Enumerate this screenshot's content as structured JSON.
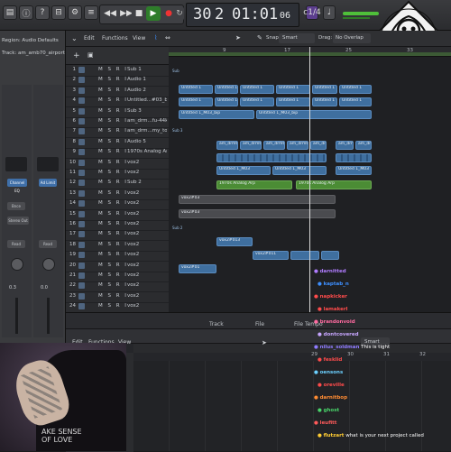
{
  "transport": {
    "rewind_icon": "rewind-icon",
    "forward_icon": "fast-forward-icon",
    "stop_icon": "stop-icon",
    "play_icon": "play-icon",
    "record_icon": "record-icon",
    "bar": "30",
    "beat": "2",
    "time": "01:01",
    "time_frac": "06",
    "key_label": "c1/4"
  },
  "tracks_toolbar": {
    "edit": "Edit",
    "functions": "Functions",
    "view": "View",
    "snap_label": "Snap:",
    "snap_value": "Smart",
    "drag_label": "Drag:",
    "drag_value": "No Overlap"
  },
  "inspector": {
    "region_line": "Region: Audio Defaults",
    "track_line": "Track: am_amb70_airport",
    "channel_eq": "Channel EQ",
    "ad_limit": "Ad Limit",
    "stereo_out": "Stereo Out",
    "read_left": "Read",
    "read_right": "Read",
    "bnce": "Bnce",
    "val_left": "0.3",
    "val_right": "0.0"
  },
  "ruler": [
    "9",
    "17",
    "25",
    "33"
  ],
  "tracks": [
    {
      "num": "1",
      "name": "Sub 1"
    },
    {
      "num": "2",
      "name": "Audio 1"
    },
    {
      "num": "3",
      "name": "Audio 2"
    },
    {
      "num": "4",
      "name": "Untitled...#03_bip"
    },
    {
      "num": "5",
      "name": "Sub 3"
    },
    {
      "num": "6",
      "name": "am_drm...fu-44k"
    },
    {
      "num": "7",
      "name": "am_drm...my_top"
    },
    {
      "num": "8",
      "name": "Audio 5"
    },
    {
      "num": "9",
      "name": "1970s Analog Arp"
    },
    {
      "num": "10",
      "name": "vox2"
    },
    {
      "num": "11",
      "name": "vox2"
    },
    {
      "num": "12",
      "name": "Sub 2"
    },
    {
      "num": "13",
      "name": "vox2"
    },
    {
      "num": "14",
      "name": "vox2"
    },
    {
      "num": "15",
      "name": "vox2"
    },
    {
      "num": "16",
      "name": "vox2"
    },
    {
      "num": "17",
      "name": "vox2"
    },
    {
      "num": "18",
      "name": "vox2"
    },
    {
      "num": "19",
      "name": "vox2"
    },
    {
      "num": "20",
      "name": "vox2"
    },
    {
      "num": "21",
      "name": "vox2"
    },
    {
      "num": "22",
      "name": "vox2"
    },
    {
      "num": "23",
      "name": "vox2"
    },
    {
      "num": "24",
      "name": "vox2"
    }
  ],
  "regions": {
    "sub1": "Sub 1",
    "untitled": "Untitled 1",
    "untitled_bip": "Untitled 1_M03_bip",
    "sub3": "Sub 3",
    "am_drm": "am_drm60",
    "untitled_m03": "Untitled 1_M03",
    "arp": "1970s Analog Arp",
    "vox_a": "vox2#03",
    "vox_b": "vox2#03",
    "sub2": "Sub 2",
    "vox_c": "vox2#013",
    "vox_d": "vox2#011",
    "vox_e": "vox2#01"
  },
  "editor": {
    "tab_track": "Track",
    "tab_file": "File",
    "tab_file_tempo": "File Tempo",
    "edit": "Edit",
    "functions": "Functions",
    "view": "View",
    "snap_value": "Smart",
    "ruler": [
      "29",
      "30",
      "31",
      "32"
    ]
  },
  "webcam": {
    "shirt_text": "AKE SENSE\nOF LOVE"
  },
  "chat": [
    {
      "name": "darnitted",
      "text": "",
      "color": "#b07cff"
    },
    {
      "name": "kaptab_n",
      "text": "",
      "color": "#3d8fff"
    },
    {
      "name": "napkicker",
      "text": "",
      "color": "#ff4b4b"
    },
    {
      "name": "lamakerl",
      "text": "",
      "color": "#ff4b4b"
    },
    {
      "name": "brandonvoid",
      "text": "",
      "color": "#ff6aa0"
    },
    {
      "name": "dontcovered",
      "text": "",
      "color": "#c7a6ff"
    },
    {
      "name": "nilus_soldman",
      "text": "This is tight",
      "color": "#8f7bff"
    },
    {
      "name": "fesklid",
      "text": "",
      "color": "#ff4b4b"
    },
    {
      "name": "oensons",
      "text": "",
      "color": "#6cd0ff"
    },
    {
      "name": "oreville",
      "text": "",
      "color": "#ff4b4b"
    },
    {
      "name": "darnitbop",
      "text": "",
      "color": "#ff8c33"
    },
    {
      "name": "ghost",
      "text": "",
      "color": "#49d46a"
    },
    {
      "name": "leufitt",
      "text": "",
      "color": "#ff5a5a"
    },
    {
      "name": "flutzart",
      "text": "what is your next project called",
      "color": "#ffcc33"
    }
  ],
  "colors": {
    "accent_green": "#4fbf3a",
    "region_blue": "#3f6f9f",
    "region_green": "#4b8c35",
    "playhead": "#d9d9d9"
  }
}
